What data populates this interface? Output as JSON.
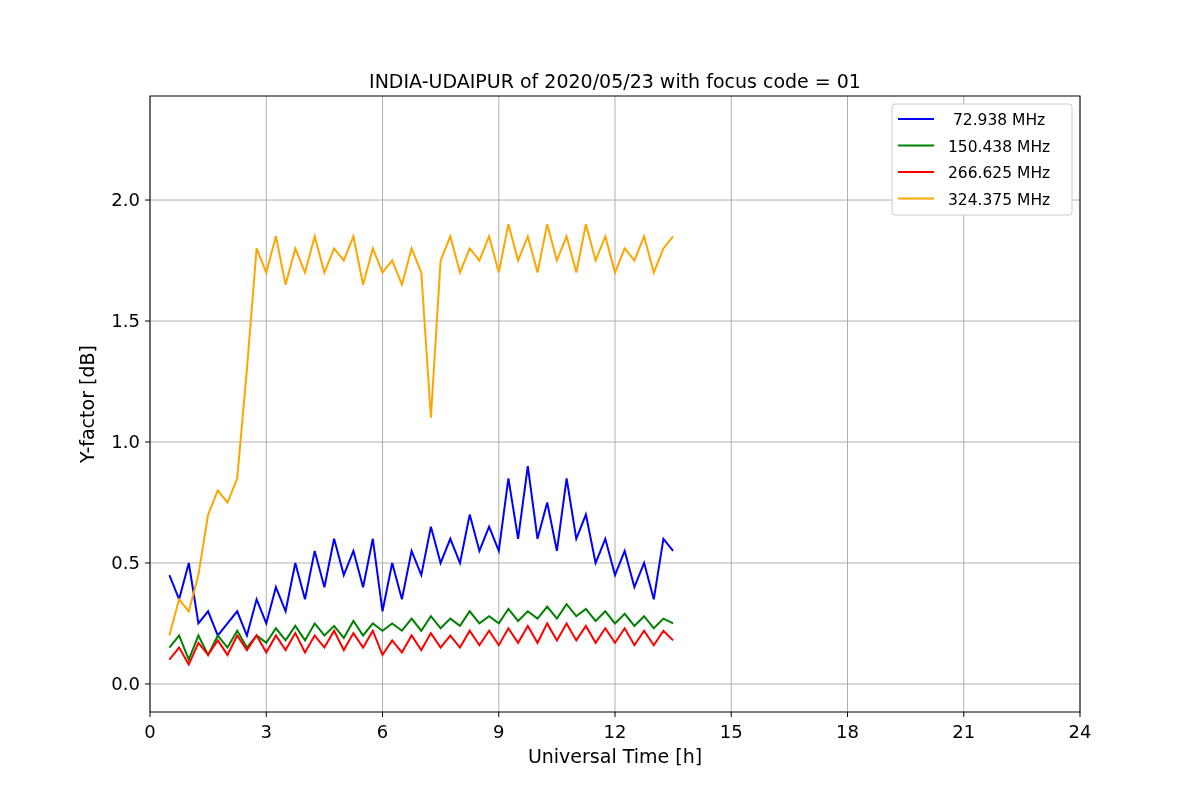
{
  "figure": {
    "chart_data": {
      "type": "line",
      "title": "INDIA-UDAIPUR of 2020/05/23 with focus code = 01",
      "xlabel": "Universal Time [h]",
      "ylabel": "Y-factor [dB]",
      "x": [
        0.5,
        0.75,
        1,
        1.25,
        1.5,
        1.75,
        2,
        2.25,
        2.5,
        2.75,
        3,
        3.25,
        3.5,
        3.75,
        4,
        4.25,
        4.5,
        4.75,
        5,
        5.25,
        5.5,
        5.75,
        6,
        6.25,
        6.5,
        6.75,
        7,
        7.25,
        7.5,
        7.75,
        8,
        8.25,
        8.5,
        8.75,
        9,
        9.25,
        9.5,
        9.75,
        10,
        10.25,
        10.5,
        10.75,
        11,
        11.25,
        11.5,
        11.75,
        12,
        12.25,
        12.5,
        12.75,
        13,
        13.25,
        13.5
      ],
      "series": [
        {
          "name": " 72.938 MHz",
          "color": "#0000ff",
          "values": [
            0.45,
            0.35,
            0.5,
            0.25,
            0.3,
            0.2,
            0.25,
            0.3,
            0.2,
            0.35,
            0.25,
            0.4,
            0.3,
            0.5,
            0.35,
            0.55,
            0.4,
            0.6,
            0.45,
            0.55,
            0.4,
            0.6,
            0.3,
            0.5,
            0.35,
            0.55,
            0.45,
            0.65,
            0.5,
            0.6,
            0.5,
            0.7,
            0.55,
            0.65,
            0.55,
            0.85,
            0.6,
            0.9,
            0.6,
            0.75,
            0.55,
            0.85,
            0.6,
            0.7,
            0.5,
            0.6,
            0.45,
            0.55,
            0.4,
            0.5,
            0.35,
            0.6,
            0.55
          ]
        },
        {
          "name": "150.438 MHz",
          "color": "#008000",
          "values": [
            0.15,
            0.2,
            0.1,
            0.2,
            0.12,
            0.2,
            0.15,
            0.22,
            0.15,
            0.2,
            0.17,
            0.23,
            0.18,
            0.24,
            0.18,
            0.25,
            0.2,
            0.24,
            0.19,
            0.26,
            0.2,
            0.25,
            0.22,
            0.25,
            0.22,
            0.27,
            0.22,
            0.28,
            0.23,
            0.27,
            0.24,
            0.3,
            0.25,
            0.28,
            0.25,
            0.31,
            0.26,
            0.3,
            0.27,
            0.32,
            0.27,
            0.33,
            0.28,
            0.31,
            0.26,
            0.3,
            0.25,
            0.29,
            0.24,
            0.28,
            0.23,
            0.27,
            0.25
          ]
        },
        {
          "name": "266.625 MHz",
          "color": "#ff0000",
          "values": [
            0.1,
            0.15,
            0.08,
            0.17,
            0.12,
            0.18,
            0.12,
            0.2,
            0.14,
            0.2,
            0.13,
            0.2,
            0.14,
            0.21,
            0.13,
            0.2,
            0.15,
            0.22,
            0.14,
            0.21,
            0.15,
            0.22,
            0.12,
            0.18,
            0.13,
            0.2,
            0.14,
            0.21,
            0.15,
            0.2,
            0.15,
            0.22,
            0.16,
            0.22,
            0.16,
            0.23,
            0.17,
            0.24,
            0.17,
            0.25,
            0.18,
            0.25,
            0.18,
            0.24,
            0.17,
            0.23,
            0.17,
            0.23,
            0.16,
            0.22,
            0.16,
            0.22,
            0.18
          ]
        },
        {
          "name": "324.375 MHz",
          "color": "#ffa500",
          "values": [
            0.2,
            0.35,
            0.3,
            0.45,
            0.7,
            0.8,
            0.75,
            0.85,
            1.3,
            1.8,
            1.7,
            1.85,
            1.65,
            1.8,
            1.7,
            1.85,
            1.7,
            1.8,
            1.75,
            1.85,
            1.65,
            1.8,
            1.7,
            1.75,
            1.65,
            1.8,
            1.7,
            1.1,
            1.75,
            1.85,
            1.7,
            1.8,
            1.75,
            1.85,
            1.7,
            1.9,
            1.75,
            1.85,
            1.7,
            1.9,
            1.75,
            1.85,
            1.7,
            1.9,
            1.75,
            1.85,
            1.7,
            1.8,
            1.75,
            1.85,
            1.7,
            1.8,
            1.85
          ]
        }
      ],
      "grid": true,
      "legend": true,
      "xlim": [
        0,
        24
      ],
      "ylim": [
        -0.116,
        2.43
      ],
      "xticks": [
        0,
        3,
        6,
        9,
        12,
        15,
        18,
        21,
        24
      ],
      "yticks": [
        {
          "value": 0,
          "label": "0.0"
        },
        {
          "value": 0.5,
          "label": "0.5"
        },
        {
          "value": 1,
          "label": "1.0"
        },
        {
          "value": 1.5,
          "label": "1.5"
        },
        {
          "value": 2,
          "label": "2.0"
        }
      ]
    }
  }
}
